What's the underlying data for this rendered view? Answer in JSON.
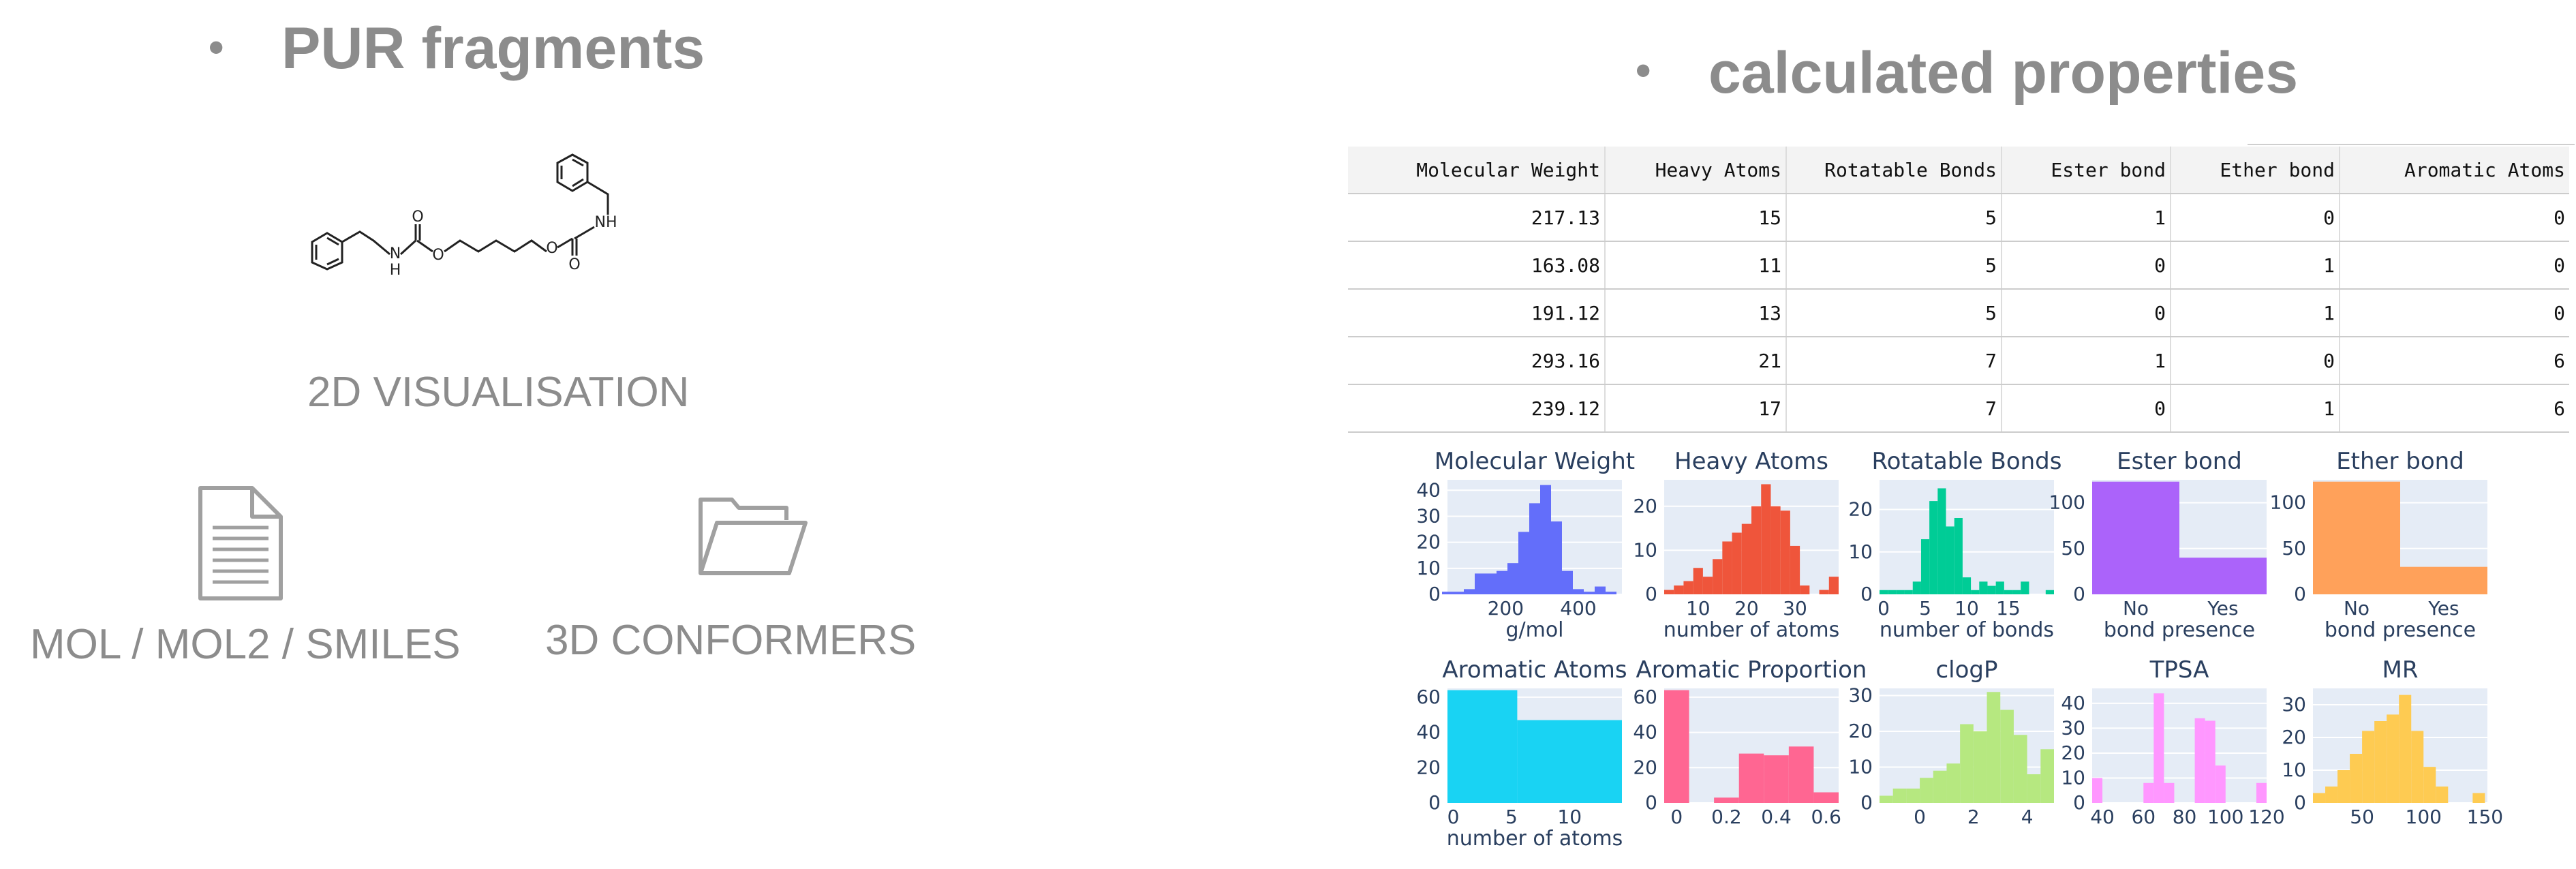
{
  "left": {
    "title": "PUR fragments",
    "bullet": "•",
    "molecule_caption": "2D VISUALISATION",
    "atom_labels": {
      "o1": "O",
      "nh1": "N",
      "h1": "H",
      "o2": "O",
      "o3": "O",
      "o4": "O",
      "nh2": "NH",
      "o5": "O"
    },
    "file_formats_label": "MOL / MOL2 / SMILES",
    "conformers_label": "3D CONFORMERS",
    "document_icon": "document-icon",
    "folder_icon": "folder-icon"
  },
  "right": {
    "title": "calculated properties",
    "bullet": "•",
    "table": {
      "columns": [
        "Molecular Weight",
        "Heavy Atoms",
        "Rotatable Bonds",
        "Ester bond",
        "Ether bond",
        "Aromatic Atoms"
      ],
      "rows": [
        [
          "217.13",
          "15",
          "5",
          "1",
          "0",
          "0"
        ],
        [
          "163.08",
          "11",
          "5",
          "0",
          "1",
          "0"
        ],
        [
          "191.12",
          "13",
          "5",
          "0",
          "1",
          "0"
        ],
        [
          "293.16",
          "21",
          "7",
          "1",
          "0",
          "6"
        ],
        [
          "239.12",
          "17",
          "7",
          "0",
          "1",
          "6"
        ]
      ]
    }
  },
  "chart_data": [
    {
      "type": "bar",
      "title": "Molecular Weight",
      "xlabel": "g/mol",
      "ylabel": "",
      "color": "#636efa",
      "x": [
        40,
        70,
        100,
        130,
        160,
        190,
        220,
        250,
        280,
        310,
        340,
        370,
        400,
        430,
        460,
        490
      ],
      "values": [
        1,
        1,
        2,
        8,
        8,
        9,
        12,
        24,
        35,
        42,
        28,
        9,
        2,
        1,
        3,
        1
      ],
      "xlim": [
        40,
        520
      ],
      "ylim": [
        0,
        44
      ],
      "xticks": [
        200,
        400
      ],
      "xticklabels": [
        "200",
        "400"
      ],
      "yticks": [
        0,
        10,
        20,
        30,
        40
      ],
      "yticklabels": [
        "0",
        "10",
        "20",
        "30",
        "40"
      ]
    },
    {
      "type": "bar",
      "title": "Heavy Atoms",
      "xlabel": "number of atoms",
      "ylabel": "",
      "color": "#ef553b",
      "x": [
        4,
        6,
        8,
        10,
        12,
        14,
        16,
        18,
        20,
        22,
        24,
        26,
        28,
        30,
        32,
        34,
        36,
        38
      ],
      "values": [
        1,
        2,
        3,
        6,
        4,
        8,
        12,
        14,
        16,
        20,
        25,
        20,
        19,
        11,
        2,
        0,
        1,
        4
      ],
      "xlim": [
        3,
        39
      ],
      "ylim": [
        0,
        26
      ],
      "xticks": [
        10,
        20,
        30
      ],
      "xticklabels": [
        "10",
        "20",
        "30"
      ],
      "yticks": [
        0,
        10,
        20
      ],
      "yticklabels": [
        "0",
        "10",
        "20"
      ]
    },
    {
      "type": "bar",
      "title": "Rotatable Bonds",
      "xlabel": "number of bonds",
      "ylabel": "",
      "color": "#00cc96",
      "x": [
        0,
        1,
        2,
        3,
        4,
        5,
        6,
        7,
        8,
        9,
        10,
        11,
        12,
        13,
        14,
        15,
        16,
        17,
        18,
        19,
        20
      ],
      "values": [
        1,
        1,
        1,
        1,
        3,
        13,
        22,
        25,
        16,
        18,
        4,
        1,
        3,
        2,
        3,
        1,
        1,
        3,
        0,
        0,
        1
      ],
      "xlim": [
        -0.5,
        20.5
      ],
      "ylim": [
        0,
        27
      ],
      "xticks": [
        0,
        5,
        10,
        15
      ],
      "xticklabels": [
        "0",
        "5",
        "10",
        "15"
      ],
      "yticks": [
        0,
        10,
        20
      ],
      "yticklabels": [
        "0",
        "10",
        "20"
      ]
    },
    {
      "type": "bar",
      "title": "Ester bond",
      "xlabel": "bond presence",
      "ylabel": "",
      "color": "#ab63fa",
      "categories": [
        "No",
        "Yes"
      ],
      "values": [
        123,
        40
      ],
      "ylim": [
        0,
        125
      ],
      "yticks": [
        0,
        50,
        100
      ],
      "yticklabels": [
        "0",
        "50",
        "100"
      ]
    },
    {
      "type": "bar",
      "title": "Ether bond",
      "xlabel": "bond presence",
      "ylabel": "",
      "color": "#ffa15a",
      "categories": [
        "No",
        "Yes"
      ],
      "values": [
        123,
        30
      ],
      "ylim": [
        0,
        125
      ],
      "yticks": [
        0,
        50,
        100
      ],
      "yticklabels": [
        "0",
        "50",
        "100"
      ]
    },
    {
      "type": "bar",
      "title": "Aromatic Atoms",
      "xlabel": "number of atoms",
      "ylabel": "",
      "color": "#19d3f3",
      "x": [
        2.5,
        10
      ],
      "values": [
        64,
        47
      ],
      "widths": [
        6,
        9
      ],
      "xlim": [
        -0.5,
        14.5
      ],
      "ylim": [
        0,
        65
      ],
      "xticks": [
        0,
        5,
        10
      ],
      "xticklabels": [
        "0",
        "5",
        "10"
      ],
      "yticks": [
        0,
        20,
        40,
        60
      ],
      "yticklabels": [
        "0",
        "20",
        "40",
        "60"
      ]
    },
    {
      "type": "bar",
      "title": "Aromatic Proportion",
      "xlabel": "",
      "ylabel": "",
      "color": "#ff6692",
      "x": [
        0,
        0.1,
        0.2,
        0.3,
        0.4,
        0.5,
        0.6
      ],
      "values": [
        64,
        0,
        3,
        28,
        27,
        32,
        6
      ],
      "xlim": [
        -0.05,
        0.65
      ],
      "ylim": [
        0,
        65
      ],
      "xticks": [
        0,
        0.2,
        0.4,
        0.6
      ],
      "xticklabels": [
        "0",
        "0.2",
        "0.4",
        "0.6"
      ],
      "yticks": [
        0,
        20,
        40,
        60
      ],
      "yticklabels": [
        "0",
        "20",
        "40",
        "60"
      ]
    },
    {
      "type": "bar",
      "title": "clogP",
      "xlabel": "",
      "ylabel": "",
      "color": "#b6e880",
      "x": [
        -1.25,
        -0.75,
        -0.25,
        0.25,
        0.75,
        1.25,
        1.75,
        2.25,
        2.75,
        3.25,
        3.75,
        4.25,
        4.75
      ],
      "values": [
        2,
        4,
        4,
        7,
        9,
        11,
        22,
        20,
        31,
        26,
        19,
        8,
        15
      ],
      "xlim": [
        -1.5,
        5
      ],
      "ylim": [
        0,
        32
      ],
      "xticks": [
        0,
        2,
        4
      ],
      "xticklabels": [
        "0",
        "2",
        "4"
      ],
      "yticks": [
        0,
        10,
        20,
        30
      ],
      "yticklabels": [
        "0",
        "10",
        "20",
        "30"
      ]
    },
    {
      "type": "bar",
      "title": "TPSA",
      "xlabel": "",
      "ylabel": "",
      "color": "#ff97ff",
      "x": [
        37.5,
        42.5,
        47.5,
        52.5,
        57.5,
        62.5,
        67.5,
        72.5,
        77.5,
        82.5,
        87.5,
        92.5,
        97.5,
        102.5,
        107.5,
        112.5,
        117.5
      ],
      "values": [
        10,
        0,
        0,
        0,
        0,
        8,
        44,
        8,
        0,
        0,
        34,
        33,
        15,
        0,
        0,
        0,
        8
      ],
      "xlim": [
        35,
        120
      ],
      "ylim": [
        0,
        46
      ],
      "xticks": [
        40,
        60,
        80,
        100,
        120
      ],
      "xticklabels": [
        "40",
        "60",
        "80",
        "100",
        "120"
      ],
      "yticks": [
        0,
        10,
        20,
        30,
        40
      ],
      "yticklabels": [
        "0",
        "10",
        "20",
        "30",
        "40"
      ]
    },
    {
      "type": "bar",
      "title": "MR",
      "xlabel": "",
      "ylabel": "",
      "color": "#fecb52",
      "x": [
        15,
        25,
        35,
        45,
        55,
        65,
        75,
        85,
        95,
        105,
        115,
        125,
        135,
        145
      ],
      "values": [
        3,
        5,
        10,
        15,
        22,
        25,
        27,
        33,
        22,
        11,
        5,
        0,
        0,
        3
      ],
      "xlim": [
        10,
        152
      ],
      "ylim": [
        0,
        35
      ],
      "xticks": [
        50,
        100,
        150
      ],
      "xticklabels": [
        "50",
        "100",
        "150"
      ],
      "yticks": [
        0,
        10,
        20,
        30
      ],
      "yticklabels": [
        "0",
        "10",
        "20",
        "30"
      ]
    }
  ]
}
